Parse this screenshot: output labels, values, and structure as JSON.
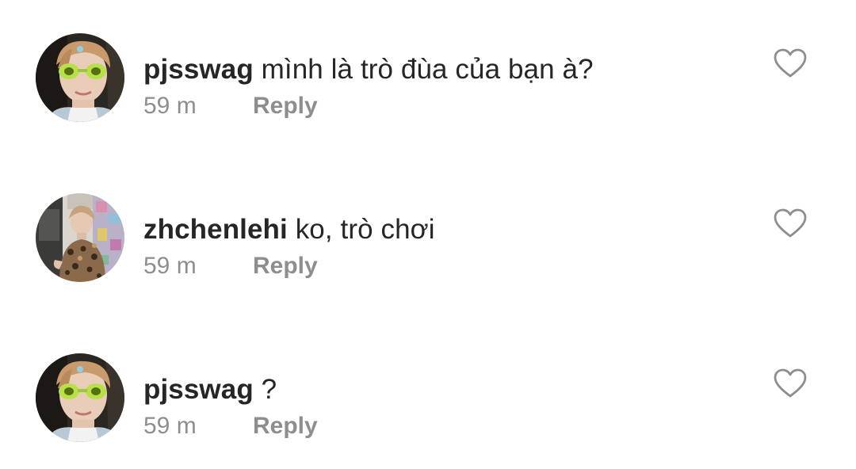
{
  "comments": [
    {
      "username": "pjsswag",
      "text": "mình là trò đùa của bạn à?",
      "time": "59 m",
      "reply_label": "Reply",
      "avatar": "avatar-sunglasses-boy",
      "like_icon": "heart-outline-icon"
    },
    {
      "username": "zhchenlehi",
      "text": "ko, trò chơi",
      "time": "59 m",
      "reply_label": "Reply",
      "avatar": "avatar-leopard-shirt-boy",
      "like_icon": "heart-outline-icon"
    },
    {
      "username": "pjsswag",
      "text": "?",
      "time": "59 m",
      "reply_label": "Reply",
      "avatar": "avatar-sunglasses-boy",
      "like_icon": "heart-outline-icon"
    }
  ],
  "colors": {
    "text_primary": "#262626",
    "text_secondary": "#8e8e8e",
    "heart_stroke": "#8e8e8e",
    "background": "#ffffff"
  }
}
